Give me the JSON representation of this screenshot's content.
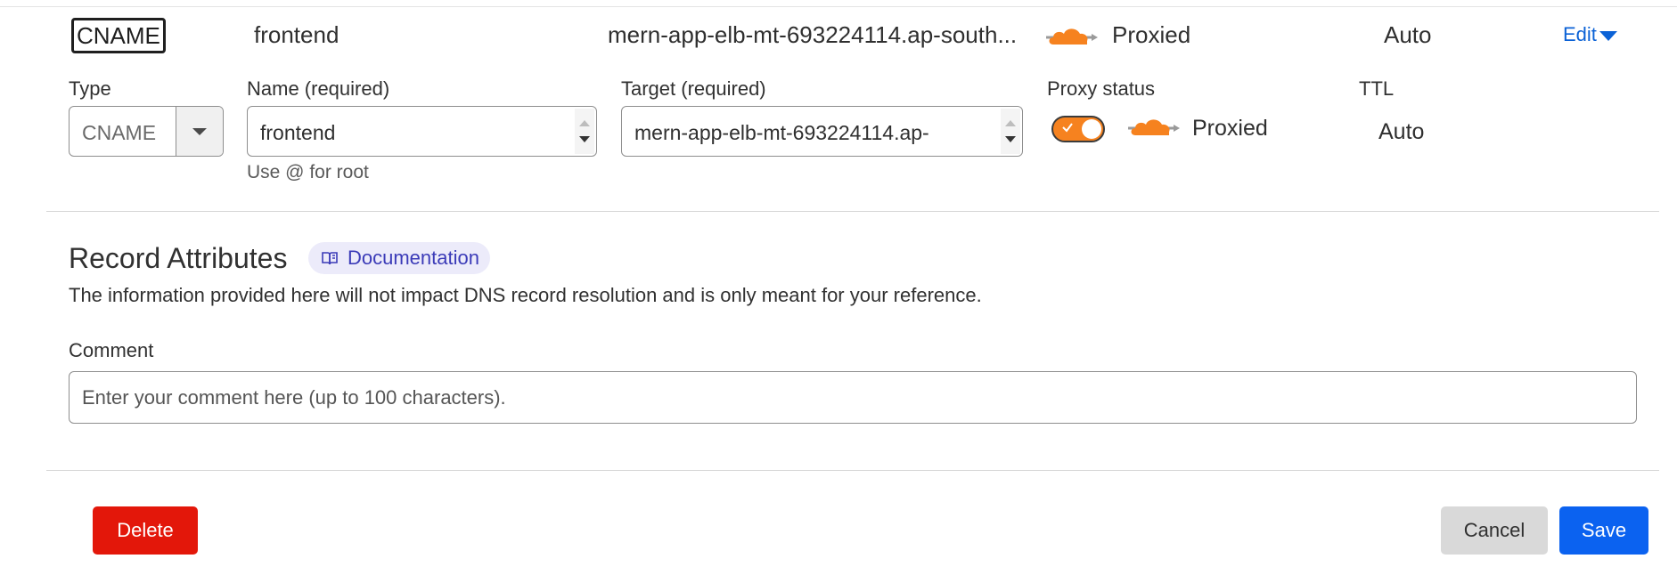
{
  "summary": {
    "type": "CNAME",
    "name": "frontend",
    "target": "mern-app-elb-mt-693224114.ap-south...",
    "proxy_status": "Proxied",
    "ttl": "Auto",
    "edit_label": "Edit"
  },
  "form": {
    "type_label": "Type",
    "type_value": "CNAME",
    "name_label": "Name (required)",
    "name_value": "frontend",
    "name_helper": "Use @ for root",
    "target_label": "Target (required)",
    "target_value": "mern-app-elb-mt-693224114.ap-",
    "proxy_label": "Proxy status",
    "proxy_value": "Proxied",
    "proxy_enabled": true,
    "ttl_label": "TTL",
    "ttl_value": "Auto"
  },
  "attributes": {
    "title": "Record Attributes",
    "doc_link": "Documentation",
    "description": "The information provided here will not impact DNS record resolution and is only meant for your reference.",
    "comment_label": "Comment",
    "comment_placeholder": "Enter your comment here (up to 100 characters).",
    "comment_value": ""
  },
  "actions": {
    "delete_label": "Delete",
    "cancel_label": "Cancel",
    "save_label": "Save"
  },
  "colors": {
    "cloud_orange": "#f6821f",
    "link_blue": "#0b62d6",
    "delete_red": "#e3170a",
    "save_blue": "#0b62f0",
    "doc_pill_bg": "#ecebfa"
  },
  "icons": {
    "proxy": "orange-cloud-icon",
    "type_dropdown": "caret-down-icon",
    "edit": "caret-down-icon",
    "documentation": "book-icon",
    "toggle_check": "check-icon",
    "spinner": "spin-arrows-icon"
  }
}
